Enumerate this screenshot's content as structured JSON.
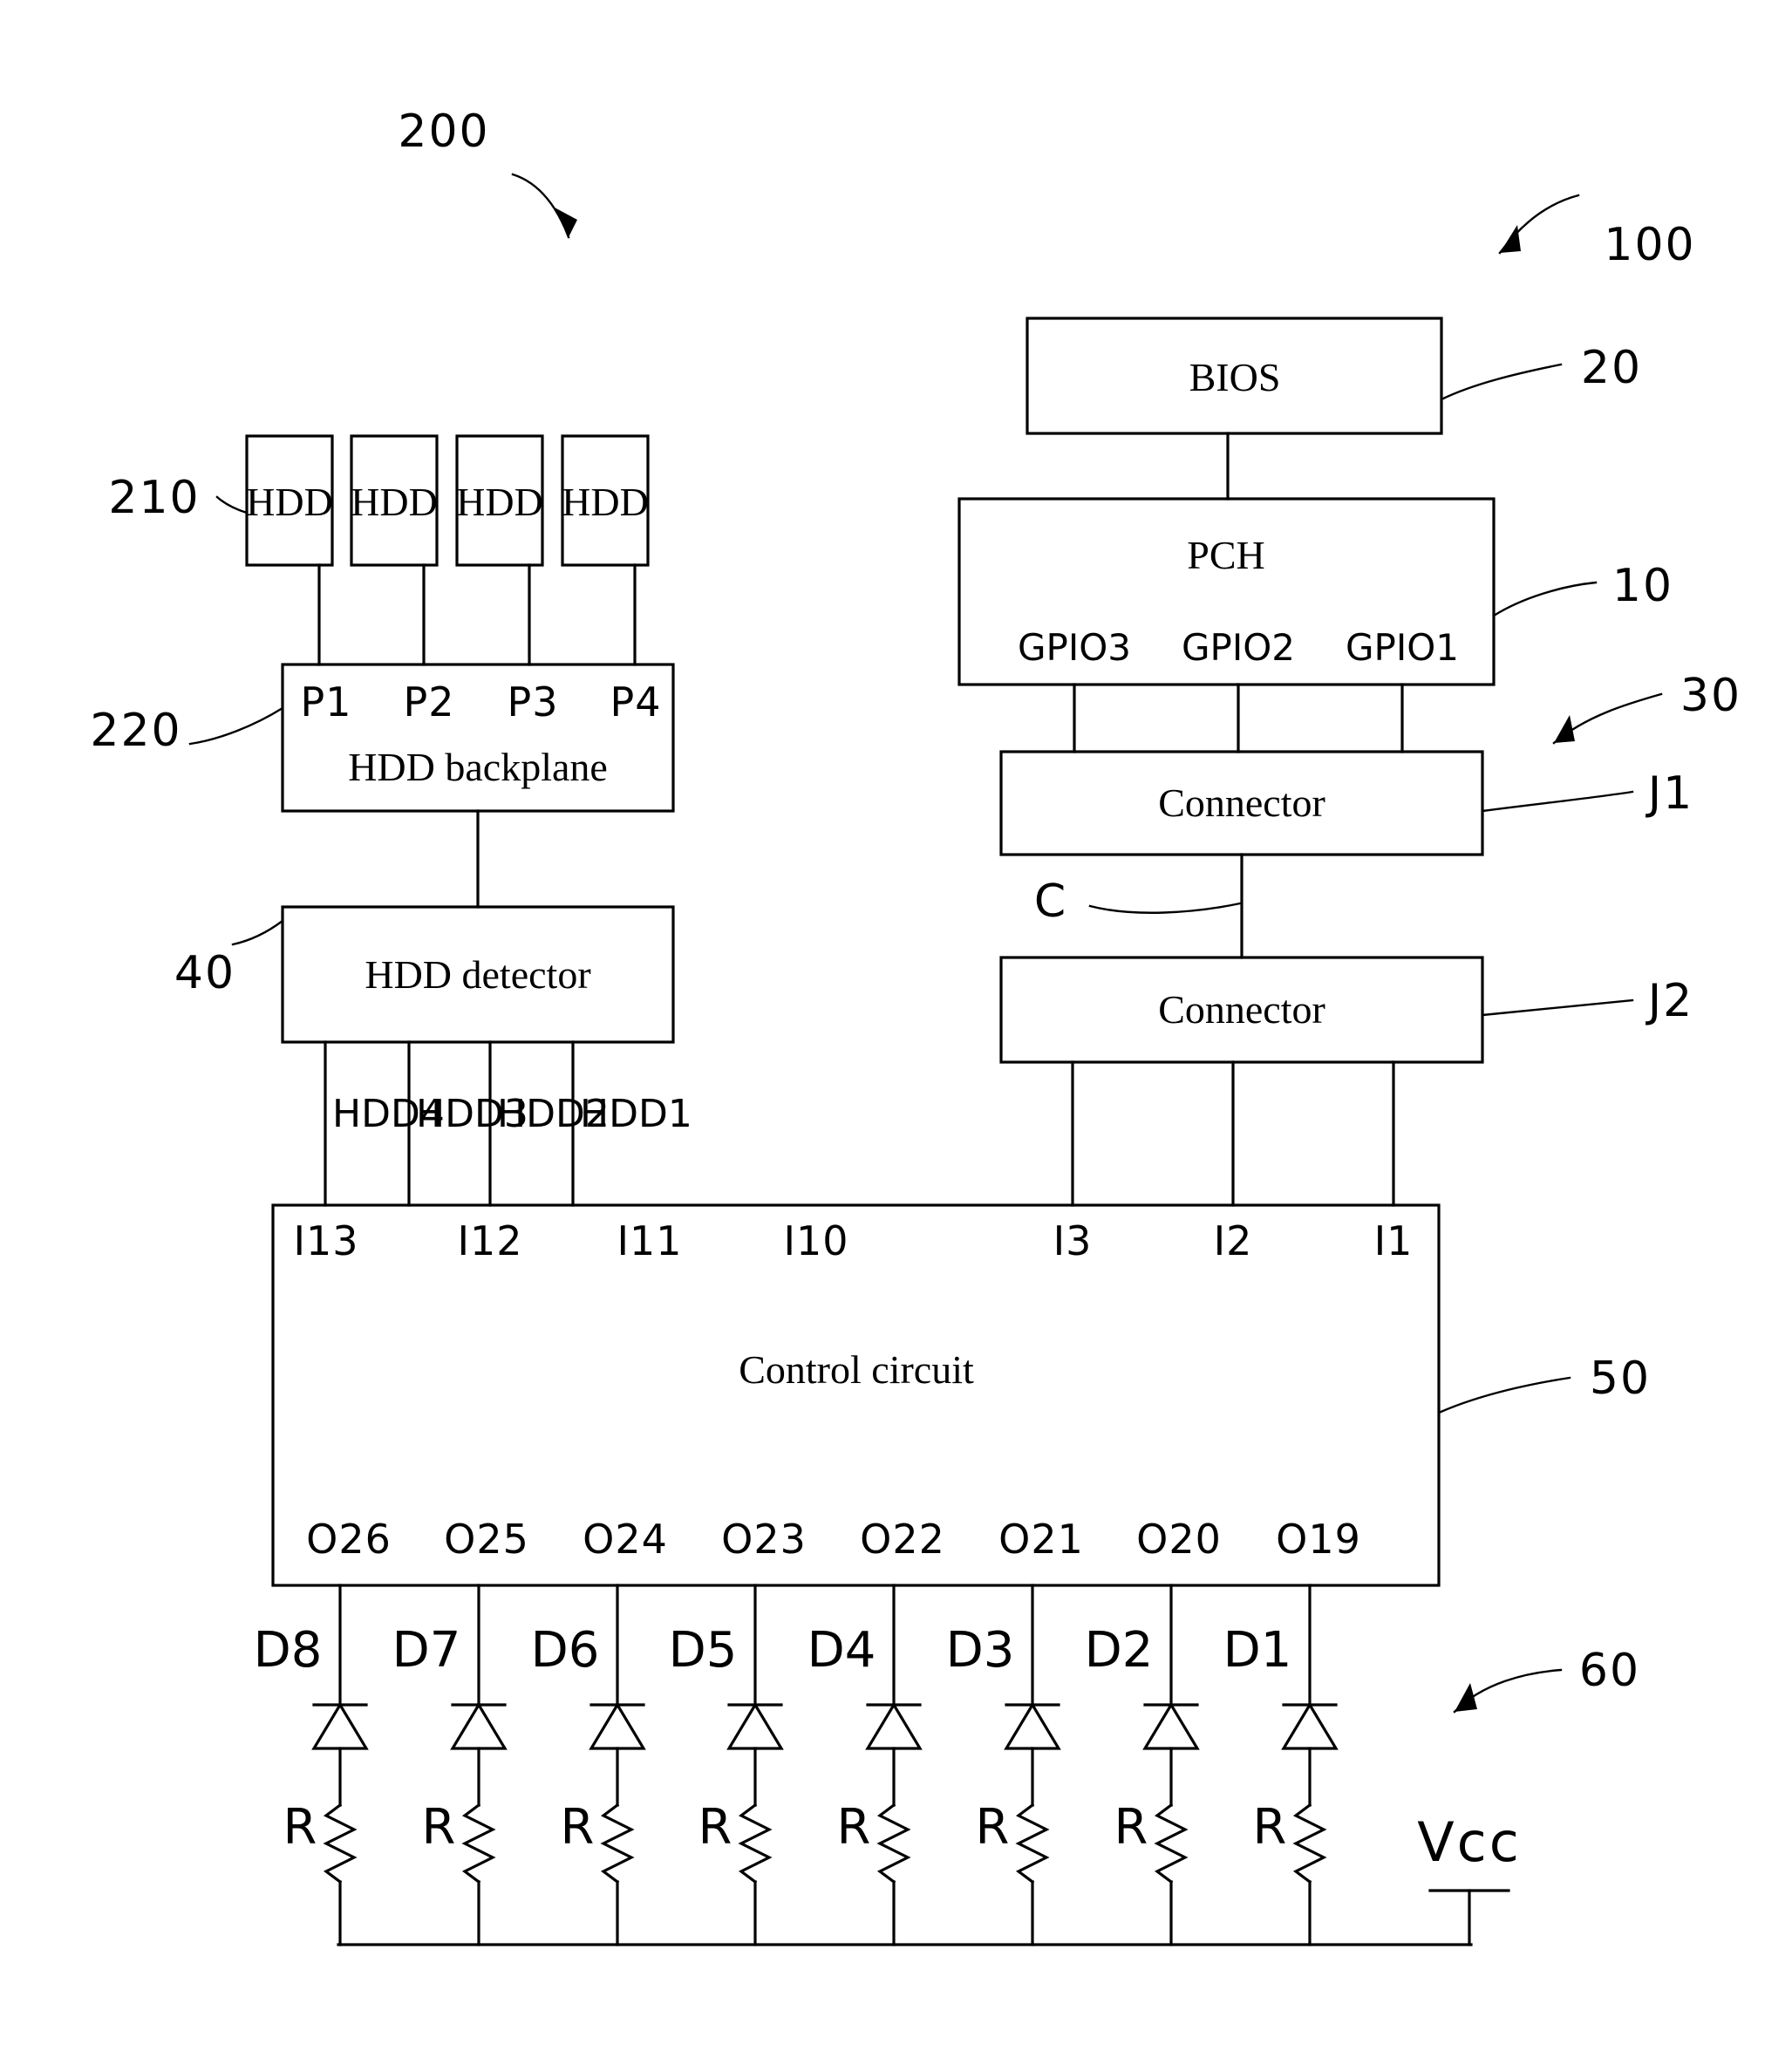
{
  "figure": {
    "refs": {
      "system_200": "200",
      "system_100": "100",
      "bios_20": "20",
      "pch_10": "10",
      "connector_group_30": "30",
      "hdd_210": "210",
      "backplane_220": "220",
      "detector_40": "40",
      "control_50": "50",
      "indicator_60": "60"
    }
  },
  "left_branch": {
    "hdd_boxes": [
      {
        "label": "HDD"
      },
      {
        "label": "HDD"
      },
      {
        "label": "HDD"
      },
      {
        "label": "HDD"
      }
    ],
    "backplane": {
      "title": "HDD backplane",
      "ports": [
        "P1",
        "P2",
        "P3",
        "P4"
      ]
    },
    "detector": {
      "title": "HDD detector",
      "signals": [
        "HDD4",
        "HDD3",
        "HDD2",
        "HDD1"
      ]
    }
  },
  "right_branch": {
    "bios": {
      "title": "BIOS"
    },
    "pch": {
      "title": "PCH",
      "gpio": [
        "GPIO3",
        "GPIO2",
        "GPIO1"
      ]
    },
    "connector_j1": {
      "title": "Connector",
      "designator": "J1"
    },
    "connector_j2": {
      "title": "Connector",
      "designator": "J2"
    },
    "cable": {
      "label": "C"
    }
  },
  "control_circuit": {
    "title": "Control circuit",
    "inputs_left": [
      "I13",
      "I12",
      "I11",
      "I10"
    ],
    "inputs_right": [
      "I3",
      "I2",
      "I1"
    ],
    "outputs": [
      "O26",
      "O25",
      "O24",
      "O23",
      "O22",
      "O21",
      "O20",
      "O19"
    ]
  },
  "indicator_array": {
    "diodes": [
      "D8",
      "D7",
      "D6",
      "D5",
      "D4",
      "D3",
      "D2",
      "D1"
    ],
    "resistors": [
      "R",
      "R",
      "R",
      "R",
      "R",
      "R",
      "R",
      "R"
    ],
    "supply": "Vcc"
  },
  "colors": {
    "ink": "#000000",
    "paper": "#ffffff"
  }
}
